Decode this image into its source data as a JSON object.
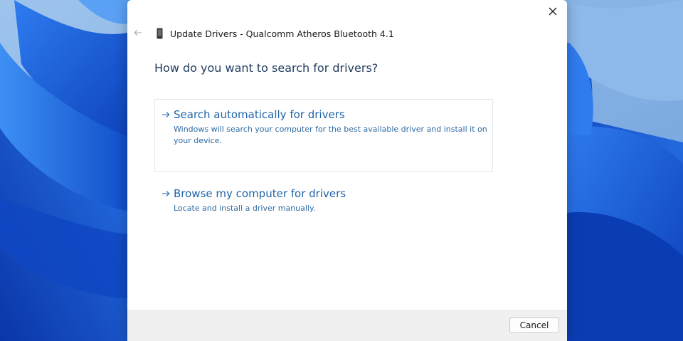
{
  "window": {
    "title": "Update Drivers - Qualcomm Atheros Bluetooth 4.1",
    "back_icon": "back-arrow-icon",
    "close_icon": "close-icon",
    "device_icon": "device-icon"
  },
  "main": {
    "heading": "How do you want to search for drivers?",
    "options": [
      {
        "title": "Search automatically for drivers",
        "description": "Windows will search your computer for the best available driver and install it on your device.",
        "icon": "arrow-right-icon"
      },
      {
        "title": "Browse my computer for drivers",
        "description": "Locate and install a driver manually.",
        "icon": "arrow-right-icon"
      }
    ]
  },
  "footer": {
    "cancel_label": "Cancel"
  },
  "colors": {
    "link": "#1f64a8",
    "heading": "#1e3a5c",
    "wallpaper_blue": "#1553d6"
  }
}
